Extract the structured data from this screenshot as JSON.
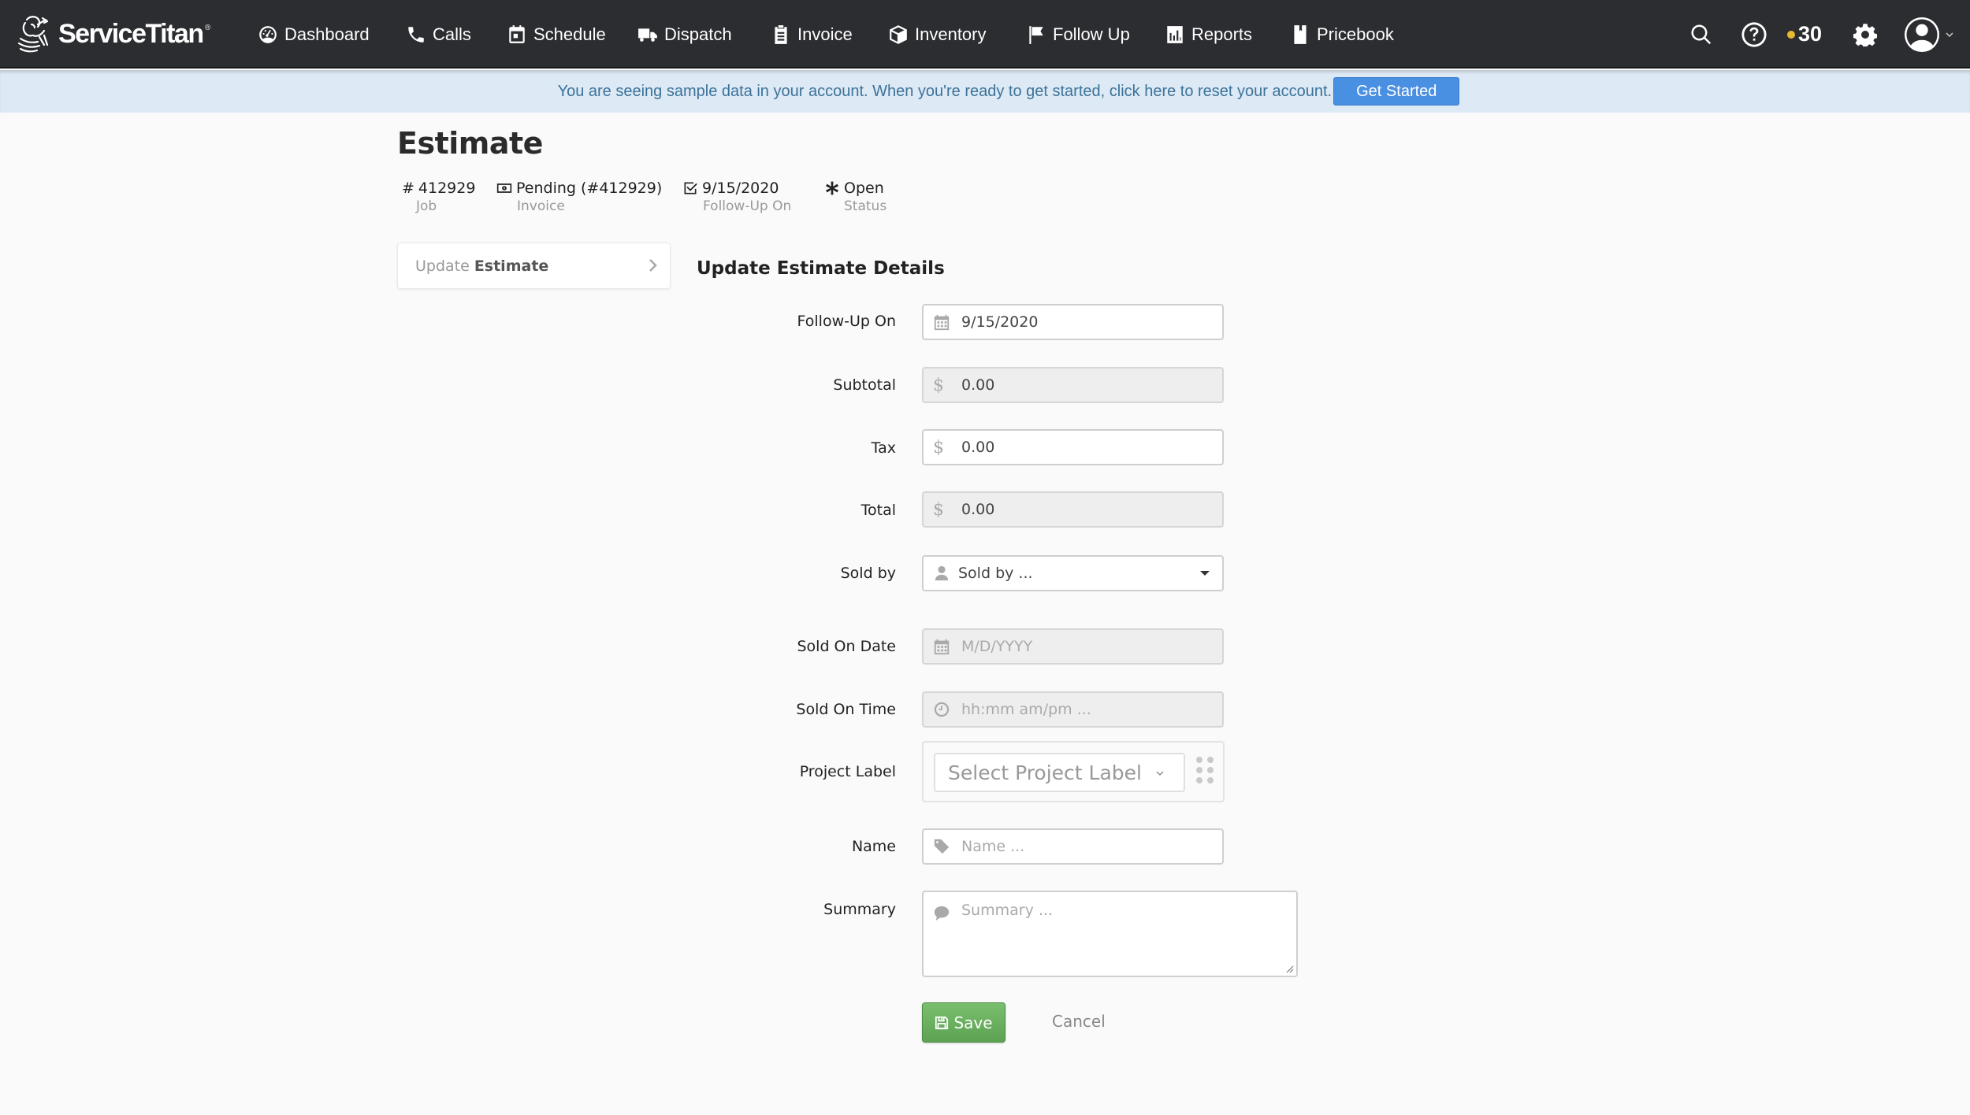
{
  "navbar": {
    "brand": "ServiceTitan",
    "brand_mark": "®",
    "items": [
      {
        "label": "Dashboard",
        "icon": "dashboard-icon"
      },
      {
        "label": "Calls",
        "icon": "phone-icon"
      },
      {
        "label": "Schedule",
        "icon": "calendar-icon"
      },
      {
        "label": "Dispatch",
        "icon": "truck-icon"
      },
      {
        "label": "Invoice",
        "icon": "clipboard-icon"
      },
      {
        "label": "Inventory",
        "icon": "box-icon"
      },
      {
        "label": "Follow Up",
        "icon": "flag-icon"
      },
      {
        "label": "Reports",
        "icon": "bar-chart-icon"
      },
      {
        "label": "Pricebook",
        "icon": "book-icon"
      }
    ],
    "notification_count": "30",
    "notification_dot_color": "#e9b831",
    "right_icons": [
      "search-icon",
      "help-icon",
      "gear-icon",
      "user-avatar-icon",
      "chevron-down-icon"
    ]
  },
  "banner": {
    "text": "You are seeing sample data in your account. When you're ready to get started, click here to reset your account.",
    "button_label": "Get Started",
    "button_color": "#4a90e2"
  },
  "page": {
    "title": "Estimate",
    "meta": [
      {
        "value": "412929",
        "prefix": "#",
        "label": "Job"
      },
      {
        "value": "Pending (#412929)",
        "label": "Invoice",
        "icon": "money-icon"
      },
      {
        "value": "9/15/2020",
        "label": "Follow-Up On",
        "icon": "checkbox-icon"
      },
      {
        "value": "Open",
        "label": "Status",
        "icon": "asterisk-icon"
      }
    ]
  },
  "sidebar": {
    "item_light": "Update",
    "item_bold": "Estimate"
  },
  "form": {
    "title": "Update Estimate Details",
    "fields": {
      "follow_up_on": {
        "label": "Follow-Up On",
        "value": "9/15/2020"
      },
      "subtotal": {
        "label": "Subtotal",
        "currency": "$",
        "value": "0.00"
      },
      "tax": {
        "label": "Tax",
        "currency": "$",
        "value": "0.00"
      },
      "total": {
        "label": "Total",
        "currency": "$",
        "value": "0.00"
      },
      "sold_by": {
        "label": "Sold by",
        "placeholder": "Sold by ..."
      },
      "sold_on_date": {
        "label": "Sold On Date",
        "placeholder": "M/D/YYYY"
      },
      "sold_on_time": {
        "label": "Sold On Time",
        "placeholder": "hh:mm am/pm ..."
      },
      "project_label": {
        "label": "Project Label",
        "placeholder": "Select Project Label"
      },
      "name": {
        "label": "Name",
        "placeholder": "Name ..."
      },
      "summary": {
        "label": "Summary",
        "placeholder": "Summary ..."
      }
    },
    "save_label": "Save",
    "cancel_label": "Cancel",
    "save_color": "#5ca252"
  }
}
